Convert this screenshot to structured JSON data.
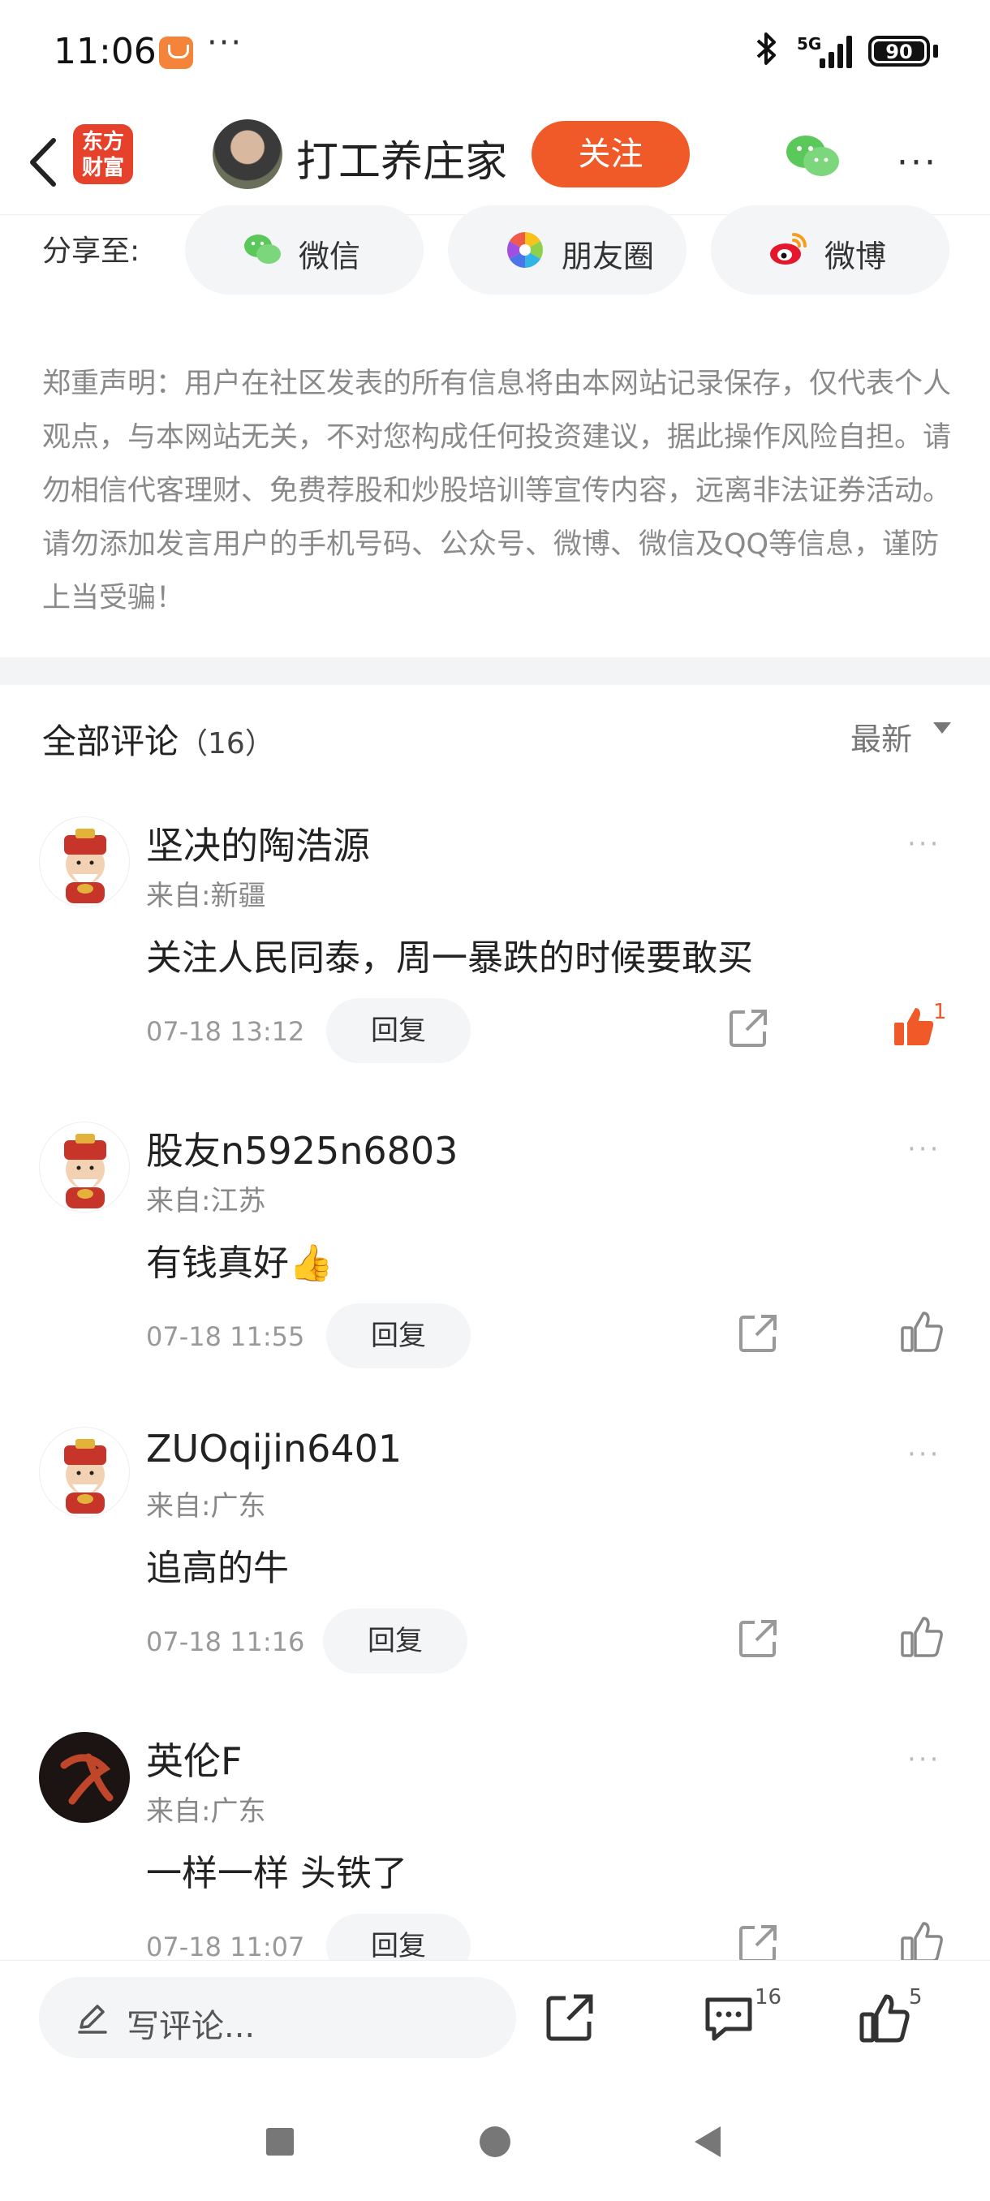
{
  "status_bar": {
    "time": "11:06",
    "dots": "···",
    "network": "5G",
    "battery": "90"
  },
  "header": {
    "logo_text": "东方财富",
    "user_name": "打工养庄家",
    "follow_label": "关注",
    "more": "···"
  },
  "share": {
    "label": "分享至:",
    "items": [
      {
        "label": "微信",
        "icon": "wechat-icon"
      },
      {
        "label": "朋友圈",
        "icon": "moments-icon"
      },
      {
        "label": "微博",
        "icon": "weibo-icon"
      }
    ]
  },
  "disclaimer": "郑重声明：用户在社区发表的所有信息将由本网站记录保存，仅代表个人观点，与本网站无关，不对您构成任何投资建议，据此操作风险自担。请勿相信代客理财、免费荐股和炒股培训等宣传内容，远离非法证券活动。请勿添加发言用户的手机号码、公众号、微博、微信及QQ等信息，谨防上当受骗！",
  "comments_header": {
    "title": "全部评论",
    "count": "（16）",
    "sort_label": "最新"
  },
  "comments": [
    {
      "name": "坚决的陶浩源",
      "location": "来自:新疆",
      "text": "关注人民同泰，周一暴跌的时候要敢买",
      "time": "07-18 13:12",
      "reply_label": "回复",
      "likes": "1",
      "liked": true,
      "avatar": "fortune-god-avatar"
    },
    {
      "name": "股友n5925n6803",
      "location": "来自:江苏",
      "text": "有钱真好👍",
      "time": "07-18 11:55",
      "reply_label": "回复",
      "likes": "",
      "liked": false,
      "avatar": "fortune-god-avatar"
    },
    {
      "name": "ZUOqijin6401",
      "location": "来自:广东",
      "text": "追高的牛",
      "time": "07-18 11:16",
      "reply_label": "回复",
      "likes": "",
      "liked": false,
      "avatar": "fortune-god-avatar"
    },
    {
      "name": "英伦F",
      "location": "来自:广东",
      "text": "一样一样 头铁了",
      "time": "07-18 11:07",
      "reply_label": "回复",
      "likes": "",
      "liked": false,
      "avatar": "dark-calligraphy-avatar"
    }
  ],
  "bottom_bar": {
    "placeholder": "写评论...",
    "comment_count": "16",
    "like_count": "5"
  },
  "colors": {
    "accent": "#f05a28",
    "brand_red": "#e6412b",
    "muted": "#8a8a8a"
  }
}
